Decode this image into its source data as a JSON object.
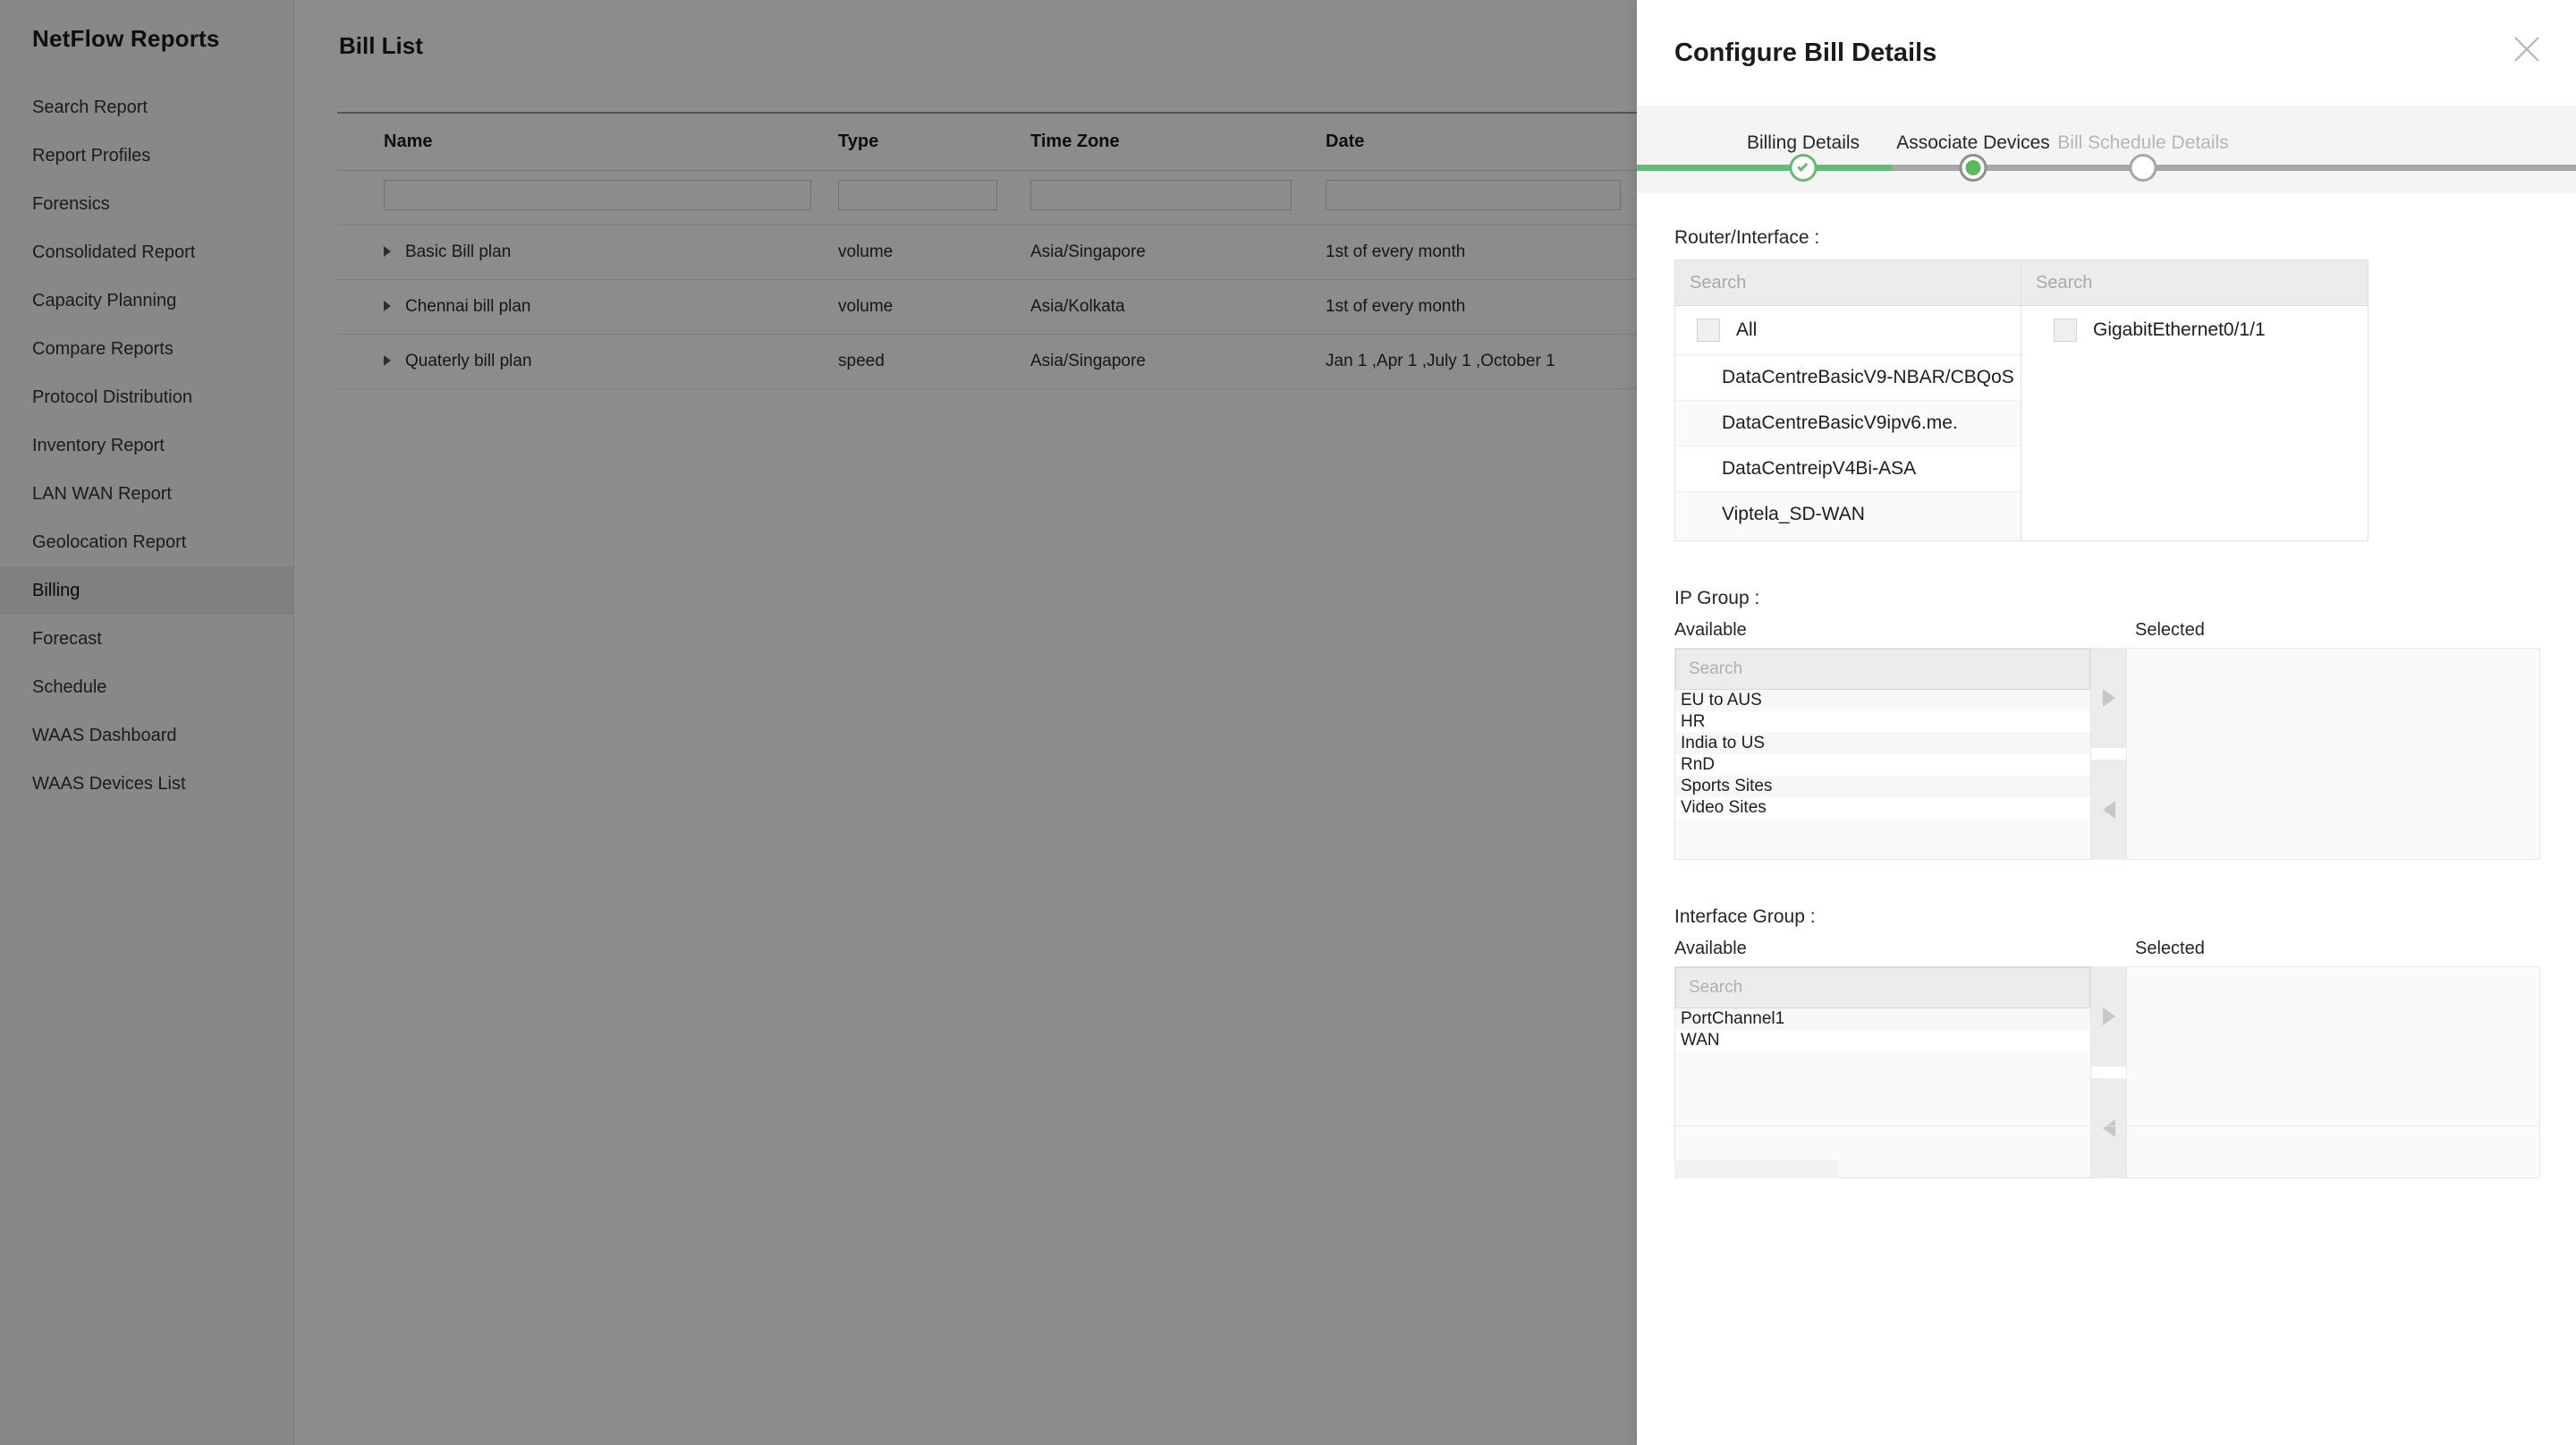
{
  "sidebar": {
    "title": "NetFlow Reports",
    "items": [
      {
        "label": "Search Report",
        "active": false
      },
      {
        "label": "Report Profiles",
        "active": false
      },
      {
        "label": "Forensics",
        "active": false
      },
      {
        "label": "Consolidated Report",
        "active": false
      },
      {
        "label": "Capacity Planning",
        "active": false
      },
      {
        "label": "Compare Reports",
        "active": false
      },
      {
        "label": "Protocol Distribution",
        "active": false
      },
      {
        "label": "Inventory Report",
        "active": false
      },
      {
        "label": "LAN WAN Report",
        "active": false
      },
      {
        "label": "Geolocation Report",
        "active": false
      },
      {
        "label": "Billing",
        "active": true
      },
      {
        "label": "Forecast",
        "active": false
      },
      {
        "label": "Schedule",
        "active": false
      },
      {
        "label": "WAAS Dashboard",
        "active": false
      },
      {
        "label": "WAAS Devices List",
        "active": false
      }
    ]
  },
  "main": {
    "title": "Bill List",
    "table": {
      "columns": [
        "Name",
        "Type",
        "Time Zone",
        "Date"
      ],
      "filter_values": [
        "",
        "",
        "",
        ""
      ],
      "rows": [
        {
          "name": "Basic Bill plan",
          "type": "volume",
          "timezone": "Asia/Singapore",
          "date": "1st of every month"
        },
        {
          "name": "Chennai bill plan",
          "type": "volume",
          "timezone": "Asia/Kolkata",
          "date": "1st of every month"
        },
        {
          "name": "Quaterly bill plan",
          "type": "speed",
          "timezone": "Asia/Singapore",
          "date": "Jan 1 ,Apr 1 ,July 1 ,October 1"
        }
      ]
    }
  },
  "modal": {
    "title": "Configure Bill Details",
    "close_icon": "close-icon",
    "steps": [
      {
        "label": "Billing Details",
        "state": "done"
      },
      {
        "label": "Associate Devices",
        "state": "current"
      },
      {
        "label": "Bill Schedule Details",
        "state": "upcoming"
      }
    ],
    "router_interface": {
      "label": "Router/Interface :",
      "router_search_placeholder": "Search",
      "router_search_value": "",
      "interface_search_placeholder": "Search",
      "interface_search_value": "",
      "all_label": "All",
      "all_checked": false,
      "devices": [
        "DataCentreBasicV9-NBAR/CBQoS",
        "DataCentreBasicV9ipv6.me.",
        "DataCentreipV4Bi-ASA",
        "Viptela_SD-WAN"
      ],
      "interfaces": [
        {
          "label": "GigabitEthernet0/1/1",
          "checked": false
        }
      ]
    },
    "ip_group": {
      "label": "IP Group :",
      "available_label": "Available",
      "selected_label": "Selected",
      "search_placeholder": "Search",
      "search_value": "",
      "available": [
        "EU to AUS",
        "HR",
        "India to US",
        "RnD",
        "Sports Sites",
        "Video Sites"
      ],
      "selected": [],
      "move_right_icon": "arrow-right-icon",
      "move_left_icon": "arrow-left-icon"
    },
    "interface_group": {
      "label": "Interface Group :",
      "available_label": "Available",
      "selected_label": "Selected",
      "search_placeholder": "Search",
      "search_value": "",
      "available": [
        "PortChannel1",
        "WAN"
      ],
      "selected": [],
      "move_right_icon": "arrow-right-icon",
      "move_left_icon": "arrow-left-icon"
    }
  },
  "colors": {
    "accent_green": "#66bb77",
    "step_done": "#5cb85c",
    "track_inactive": "#a7a7a7",
    "sidebar_active": "#e9e9e9"
  }
}
